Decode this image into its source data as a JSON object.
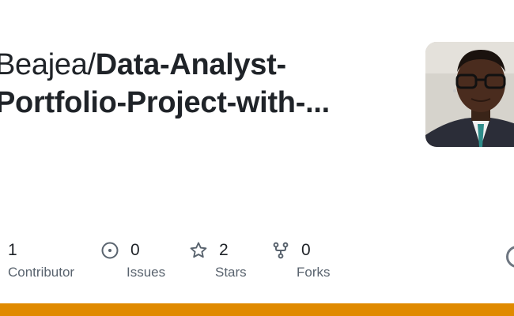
{
  "repo": {
    "owner": "Beajea/",
    "name_line1": "Data-Analyst-",
    "name_line2": "Portfolio-Project-with-..."
  },
  "stats": {
    "contributors": {
      "value": "1",
      "label": "Contributor"
    },
    "issues": {
      "value": "0",
      "label": "Issues",
      "icon": "issue-icon"
    },
    "stars": {
      "value": "2",
      "label": "Stars",
      "icon": "star-icon"
    },
    "forks": {
      "value": "0",
      "label": "Forks",
      "icon": "fork-icon"
    }
  },
  "colors": {
    "accent_bar": "#e08a00",
    "text": "#1f2328",
    "muted": "#59636e"
  }
}
